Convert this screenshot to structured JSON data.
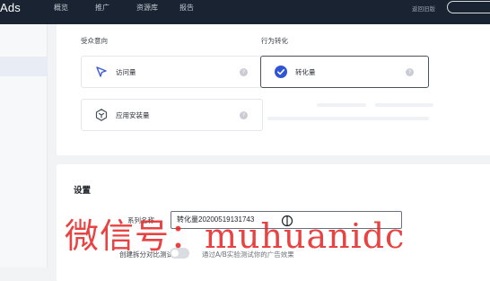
{
  "topbar": {
    "brand": "Ads",
    "nav": [
      "概览",
      "推广",
      "资源库",
      "报告"
    ],
    "back_link": "返回旧版"
  },
  "audience_section": {
    "label": "受众意向",
    "options": [
      {
        "label": "访问量",
        "icon": "cursor-arrow-icon"
      },
      {
        "label": "应用安装量",
        "icon": "cube-icon"
      }
    ]
  },
  "behavior_section": {
    "label": "行为转化",
    "options": [
      {
        "label": "转化量",
        "icon": "check-circle-icon",
        "selected": true
      }
    ]
  },
  "settings": {
    "title": "设置",
    "series_name_label": "系列名称",
    "series_name_value": "转化量20200519131743",
    "split_test_label": "创建拆分对比测试",
    "split_test_enabled": false,
    "split_test_desc": "通过A/B实验测试你的广告效果"
  },
  "watermark": "微信号：muhuanidc",
  "colors": {
    "topbar": "#1a2332",
    "accent": "#3a5bd9",
    "watermark": "#e62828"
  }
}
